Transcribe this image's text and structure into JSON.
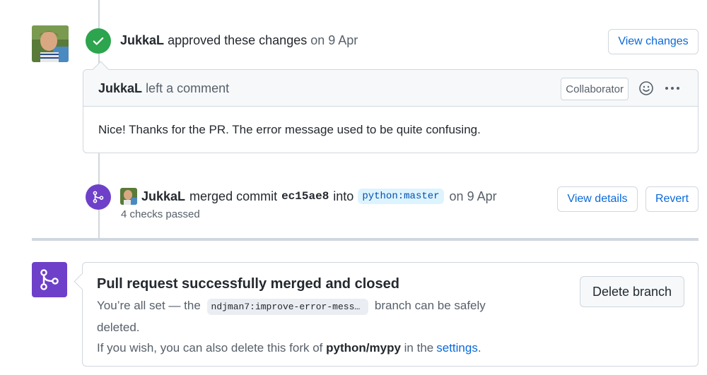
{
  "review": {
    "author": "JukkaL",
    "action": "approved these changes",
    "date": "on 9 Apr",
    "view_changes_label": "View changes"
  },
  "comment": {
    "author": "JukkaL",
    "action": "left a comment",
    "role_label": "Collaborator",
    "body": "Nice! Thanks for the PR. The error message used to be quite confusing.",
    "reaction_icon": "smiley-icon",
    "menu_icon": "kebab-horizontal-icon"
  },
  "merge": {
    "author": "JukkaL",
    "action": "merged commit",
    "commit": "ec15ae8",
    "into": "into",
    "target_branch": "python:master",
    "date": "on 9 Apr",
    "checks": "4 checks passed",
    "view_details_label": "View details",
    "revert_label": "Revert"
  },
  "merged_panel": {
    "title": "Pull request successfully merged and closed",
    "line1_prefix": "You’re all set — the",
    "branch": "ndjman7:improve-error-mess…",
    "line1_suffix": "branch can be safely",
    "line2": "deleted.",
    "line3_prefix": "If you wish, you can also delete this fork of",
    "repo": "python/mypy",
    "line3_middle": "in the",
    "settings_link": "settings",
    "line3_suffix": ".",
    "delete_branch_label": "Delete branch"
  },
  "colors": {
    "approved_green": "#2da44e",
    "merged_purple": "#6e40c9",
    "link_blue": "#0969da"
  }
}
